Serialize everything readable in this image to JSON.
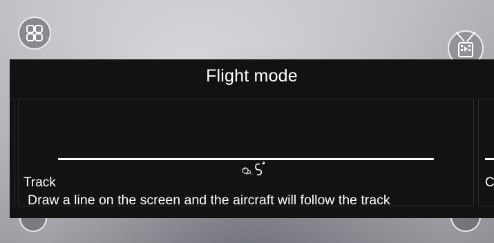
{
  "panel": {
    "title": "Flight mode"
  },
  "modes": [
    {
      "name": "Track",
      "description": "Draw a line on the screen and the aircraft will follow the track",
      "icon": "hand-drawing-track-icon",
      "selected": true
    },
    {
      "name": "C"
    }
  ],
  "buttons": {
    "menu_icon": "grid-menu-icon",
    "film_icon": "film-icon"
  },
  "colors": {
    "panel_bg": "#121212",
    "text": "#ffffff"
  }
}
